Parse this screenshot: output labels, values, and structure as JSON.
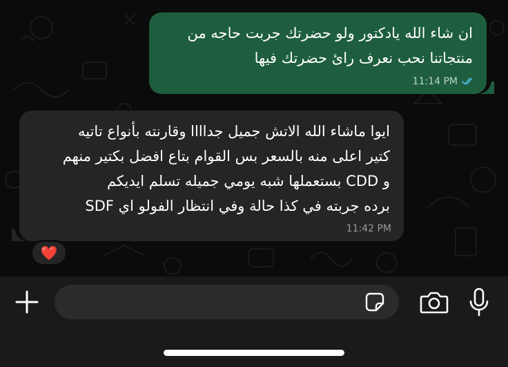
{
  "messages": [
    {
      "direction": "outgoing",
      "text": "ان شاء الله يادكتور ولو حضرتك جربت حاجه من\nمنتجاتنا نحب نعرف رائ حضرتك فيها",
      "time": "11:14 PM",
      "status_icon": "double-check-read-icon"
    },
    {
      "direction": "incoming",
      "text": "ايوا ماشاء الله الاتش جميل جداااا وقارنته بأنواع تاتيه\nكتير اعلى منه بالسعر بس القوام بتاع افضل بكتير منهم\nو CDD بستعملها شبه يومي جميله تسلم ايديكم\nبرده جربته في كذا حالة وفي انتظار الفولو اي SDF",
      "time": "11:42 PM",
      "reaction": "❤️"
    }
  ],
  "composer": {
    "placeholder": "",
    "attach_icon": "plus-icon",
    "sticker_icon": "sticker-icon",
    "camera_icon": "camera-icon",
    "mic_icon": "microphone-icon"
  },
  "colors": {
    "outgoing_bubble": "#1e5e3e",
    "incoming_bubble": "#252525",
    "read_tick": "#53bdeb"
  }
}
